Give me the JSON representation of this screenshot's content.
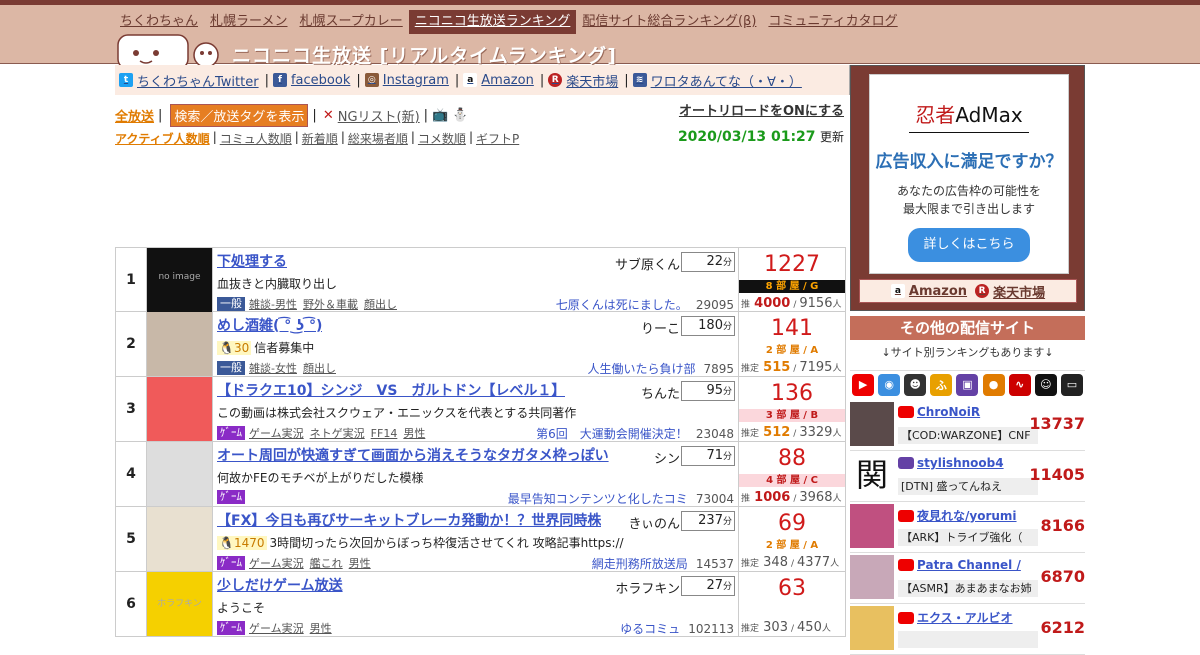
{
  "nav": [
    {
      "label": "ちくわちゃん",
      "active": false
    },
    {
      "label": "札幌ラーメン",
      "active": false
    },
    {
      "label": "札幌スープカレー",
      "active": false
    },
    {
      "label": "ニコニコ生放送ランキング",
      "active": true
    },
    {
      "label": "配信サイト総合ランキング(β)",
      "active": false
    },
    {
      "label": "コミュニティカタログ",
      "active": false
    }
  ],
  "site_title": "ニコニコ生放送 [リアルタイムランキング]",
  "social": {
    "twitter": "ちくわちゃんTwitter",
    "facebook": "facebook",
    "instagram": "Instagram",
    "amazon": "Amazon",
    "rakuten": "楽天市場",
    "wrotanante": "ワロタあんてな（・∀・）",
    "sep": "|"
  },
  "filters": {
    "all": "全放送",
    "tag_button": "検索／放送タグを表示",
    "ng": "NGリスト(新)",
    "autoreload": "オートリロードをONにする",
    "sorts": [
      "アクティブ人数順",
      "コミュ人数順",
      "新着順",
      "総来場者順",
      "コメ数順",
      "ギフトP"
    ],
    "datetime": "2020/03/13 01:27",
    "update_label": "更新"
  },
  "ranking": [
    {
      "rank": "1",
      "title": "下処理する",
      "user": "サブ原くん",
      "minutes": "22",
      "min_unit": "分",
      "desc": "血抜きと内臓取り出し",
      "level": "",
      "category": "一般",
      "category_kind": "gen",
      "tags": [
        "雑談-男性",
        "野外＆車載",
        "顔出し"
      ],
      "community": "七原くんは死にました。",
      "community_num": "29095",
      "viewers": "1227",
      "room": "8 部 屋 / G",
      "room_style": "black",
      "est_label": "推",
      "est": "4000",
      "total": "9156",
      "person_unit": "人",
      "thumb": {
        "bg": "#111",
        "text": "no image"
      }
    },
    {
      "rank": "2",
      "title": "めし酒雑(  ͡° ͜ʖ ͡°)",
      "user": "りーこ",
      "minutes": "180",
      "min_unit": "分",
      "desc": "信者募集中",
      "level": "30",
      "category": "一般",
      "category_kind": "gen",
      "tags": [
        "雑談-女性",
        "顔出し"
      ],
      "community": "人生働いたら負け部",
      "community_num": "7895",
      "viewers": "141",
      "room": "2 部 屋 / A",
      "room_style": "plain",
      "est_label": "推定",
      "est": "515",
      "total": "7195",
      "person_unit": "人",
      "thumb": {
        "bg": "#c8b8a8",
        "text": ""
      }
    },
    {
      "rank": "3",
      "title": "【ドラクエ10】シンジ　VS　ガルトドン【レベル１】",
      "user": "ちんた",
      "minutes": "95",
      "min_unit": "分",
      "desc": "この動画は株式会社スクウェア・エニックスを代表とする共同著作",
      "level": "",
      "category": "ｹﾞｰﾑ",
      "category_kind": "game",
      "tags": [
        "ゲーム実況",
        "ネトゲ実況",
        "FF14",
        "男性"
      ],
      "community": "第6回　大運動会開催決定！",
      "community_num": "23048",
      "viewers": "136",
      "room": "3 部 屋 / B",
      "room_style": "pink",
      "est_label": "推定",
      "est": "512",
      "total": "3329",
      "person_unit": "人",
      "thumb": {
        "bg": "#f05a5a",
        "text": ""
      }
    },
    {
      "rank": "4",
      "title": "オート周回が快適すぎて画面から消えそうなタガタメ枠っぽい",
      "user": "シン",
      "minutes": "71",
      "min_unit": "分",
      "desc": "何故かFEのモチベが上がりだした模様",
      "level": "",
      "category": "ｹﾞｰﾑ",
      "category_kind": "game",
      "tags": [],
      "community": "最早告知コンテンツと化したコミ",
      "community_num": "73004",
      "viewers": "88",
      "room": "4 部 屋 / C",
      "room_style": "pink",
      "est_label": "推",
      "est": "1006",
      "total": "3968",
      "person_unit": "人",
      "thumb": {
        "bg": "#ddd",
        "text": ""
      }
    },
    {
      "rank": "5",
      "title": "【FX】今日も再びサーキットブレーカ発動か！？世界同時株",
      "user": "きぃのん",
      "minutes": "237",
      "min_unit": "分",
      "desc": "3時間切ったら次回からぼっち枠復活させてくれ 攻略記事https://",
      "level": "1470",
      "category": "ｹﾞｰﾑ",
      "category_kind": "game",
      "tags": [
        "ゲーム実況",
        "艦これ",
        "男性"
      ],
      "community": "網走刑務所放送局",
      "community_num": "14537",
      "viewers": "69",
      "room": "2 部 屋 / A",
      "room_style": "plain",
      "est_label": "推定",
      "est": "348",
      "total": "4377",
      "person_unit": "人",
      "thumb": {
        "bg": "#e8e0d0",
        "text": ""
      }
    },
    {
      "rank": "6",
      "title": "少しだけゲーム放送",
      "user": "ホラフキン",
      "minutes": "27",
      "min_unit": "分",
      "desc": "ようこそ",
      "level": "",
      "category": "ｹﾞｰﾑ",
      "category_kind": "game",
      "tags": [
        "ゲーム実況",
        "男性"
      ],
      "community": "ゆるコミュ",
      "community_num": "102113",
      "viewers": "63",
      "room": "",
      "room_style": "plain",
      "est_label": "推定",
      "est": "303",
      "total": "450",
      "person_unit": "人",
      "thumb": {
        "bg": "#f5d000",
        "text": "ホラフキン"
      }
    }
  ],
  "ad": {
    "brand_a": "忍者",
    "brand_b": "AdMax",
    "headline": "広告収入に満足ですか？",
    "body_1": "あなたの広告枠の可能性を",
    "body_2": "最大限まで引き出します",
    "button": "詳しくはこちら",
    "amazon": "Amazon",
    "rakuten": "楽天市場"
  },
  "other_sites": {
    "heading": "その他の配信サイト",
    "note": "↓サイト別ランキングもあります↓",
    "icons": [
      "youtube-icon",
      "openrec-icon",
      "niconico-icon",
      "fuwa-icon",
      "twitch-icon",
      "showroom-icon",
      "mixer-icon",
      "kakao-icon",
      "tv-icon"
    ]
  },
  "streams": [
    {
      "name": "ChroNoiR",
      "title": "【COD:WARZONE】CNF",
      "viewers": "13737",
      "platform": "youtube",
      "avatar_bg": "#5a4a4a"
    },
    {
      "name": "stylishnoob4",
      "title": "[DTN] 盛ってんねえ",
      "viewers": "11405",
      "platform": "twitch",
      "avatar_bg": "#fff",
      "avatar_text": "関"
    },
    {
      "name": "夜見れな/yorumi",
      "title": "【ARK】トライブ強化（",
      "viewers": "8166",
      "platform": "youtube",
      "avatar_bg": "#c05080"
    },
    {
      "name": "Patra Channel /",
      "title": "【ASMR】あまあまなお姉",
      "viewers": "6870",
      "platform": "youtube",
      "avatar_bg": "#c8a8b8"
    },
    {
      "name": "エクス・アルビオ",
      "title": "",
      "viewers": "6212",
      "platform": "youtube",
      "avatar_bg": "#e8c060"
    }
  ]
}
